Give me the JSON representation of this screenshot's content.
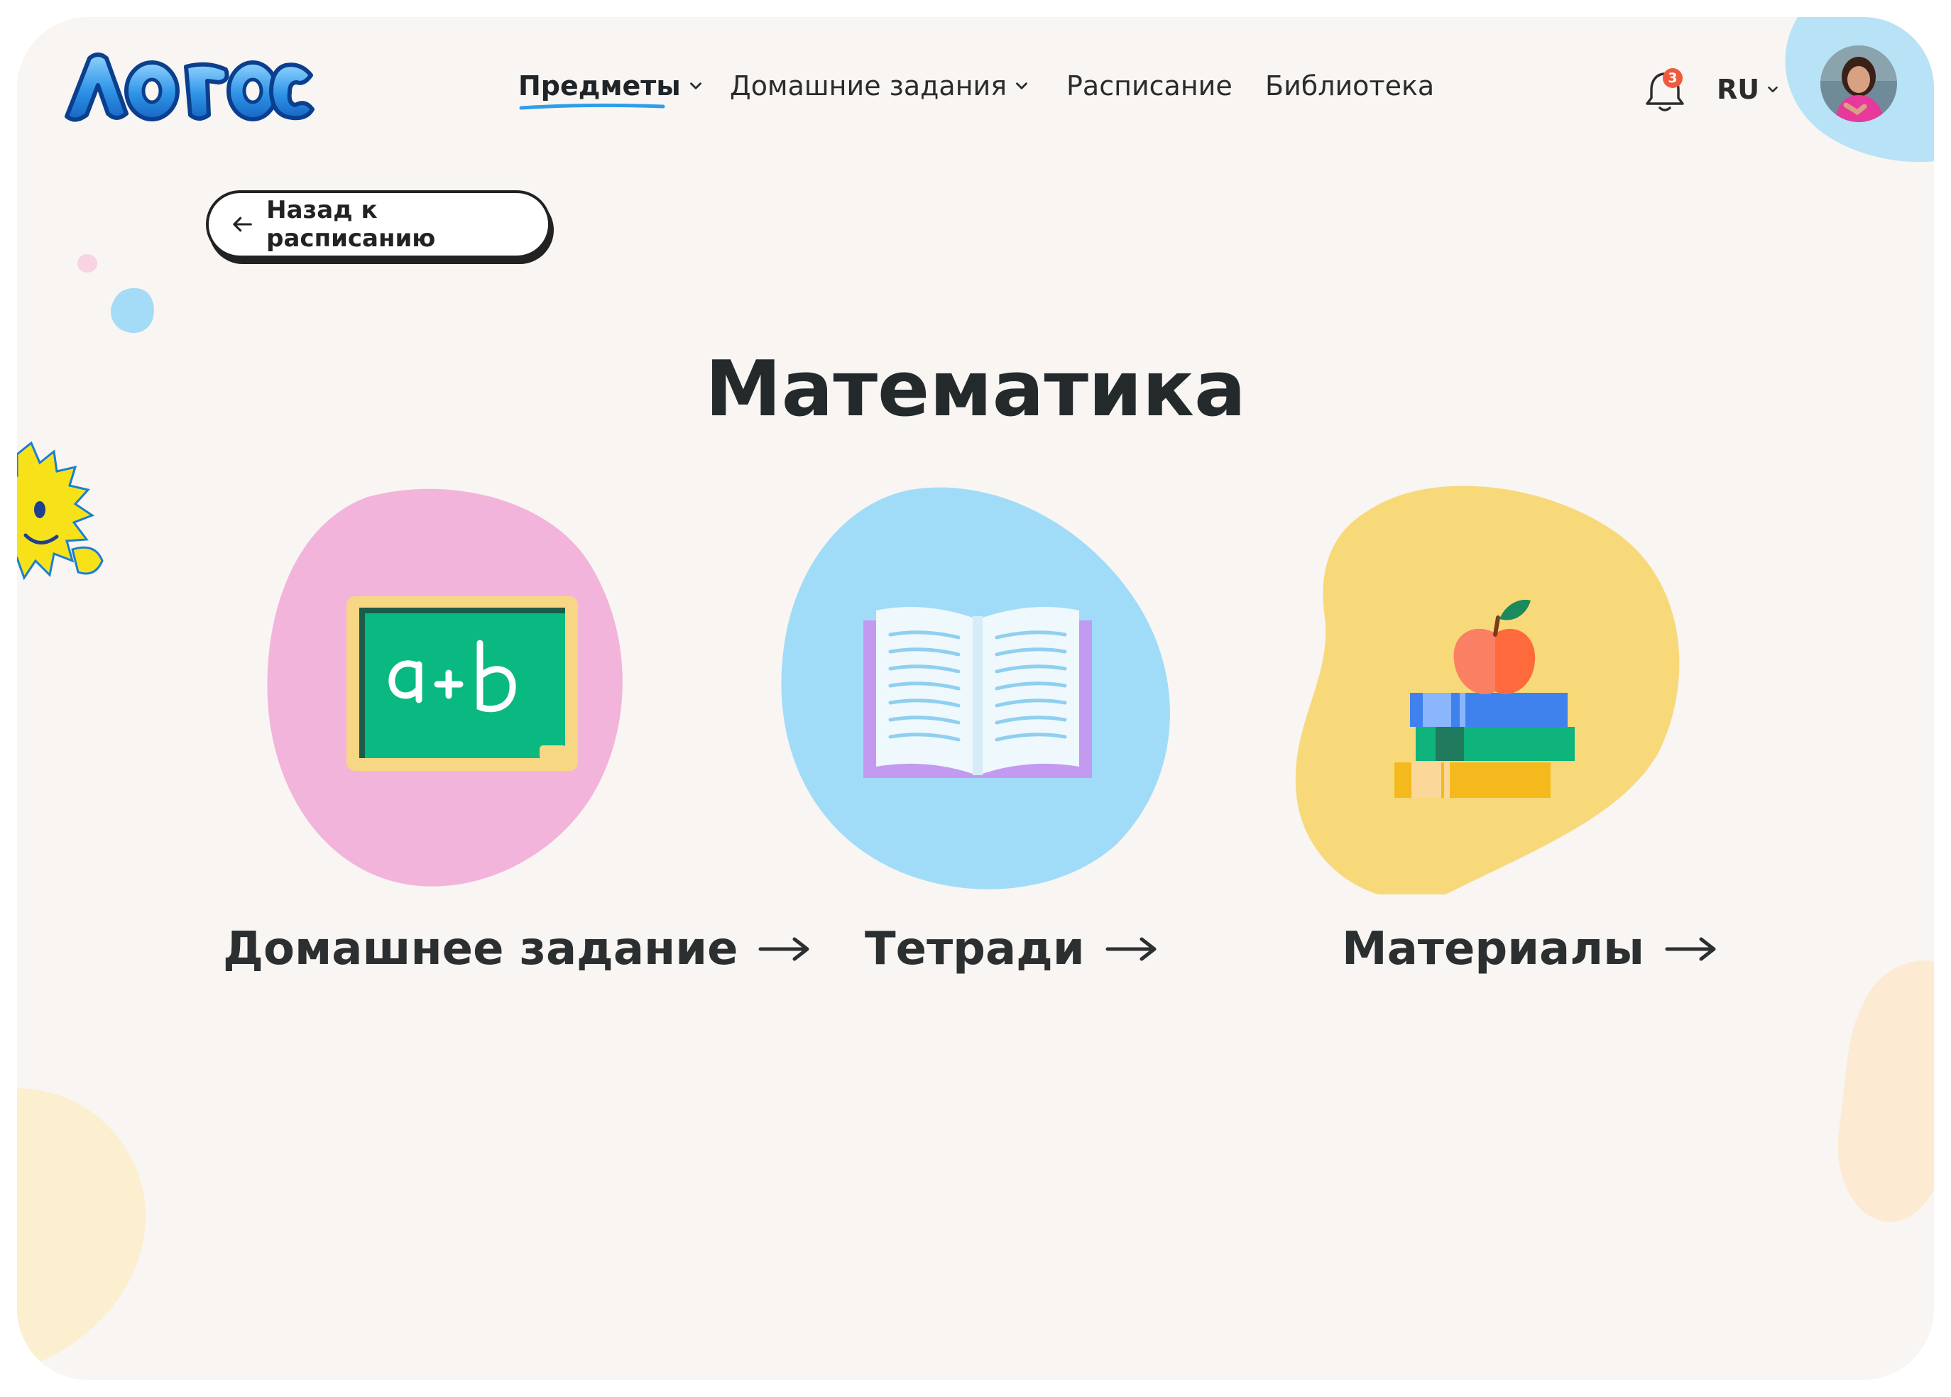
{
  "nav": {
    "items": [
      {
        "label": "Предметы",
        "active": true,
        "has_dropdown": true
      },
      {
        "label": "Домашние задания",
        "active": false,
        "has_dropdown": true
      },
      {
        "label": "Расписание",
        "active": false,
        "has_dropdown": false
      },
      {
        "label": "Библиотека",
        "active": false,
        "has_dropdown": false
      }
    ]
  },
  "header": {
    "logo_text": "ЛОГОС",
    "notifications_count": "3",
    "language": "RU"
  },
  "back_button": {
    "label": "Назад к расписанию"
  },
  "page": {
    "title": "Математика"
  },
  "cards": [
    {
      "label": "Домашнее задание",
      "icon": "chalkboard-icon",
      "color": "#f2b4da"
    },
    {
      "label": "Тетради",
      "icon": "open-book-icon",
      "color": "#a0dcf8"
    },
    {
      "label": "Материалы",
      "icon": "books-apple-icon",
      "color": "#f7d97a"
    }
  ],
  "colors": {
    "background": "#f8f5f2",
    "accent_blue": "#2f8fd8",
    "text_dark": "#242a2c",
    "badge_red": "#ef5a3c"
  }
}
